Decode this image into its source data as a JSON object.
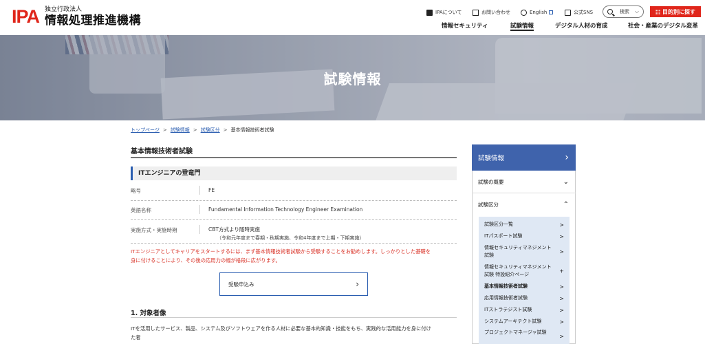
{
  "header": {
    "logo_mark": "IPA",
    "logo_sub": "独立行政法人",
    "logo_main": "情報処理推進機構",
    "util_links": [
      {
        "label": "IPAについて",
        "icon": "square-icon"
      },
      {
        "label": "お問い合わせ",
        "icon": "mail-icon"
      },
      {
        "label": "English",
        "icon": "globe-icon"
      },
      {
        "label": "公式SNS",
        "icon": "sns-icon"
      }
    ],
    "search_label": "検索",
    "purpose_button": "目的別に探す",
    "nav": [
      "情報セキュリティ",
      "試験情報",
      "デジタル人材の育成",
      "社会・産業のデジタル変革"
    ],
    "active_nav": "試験情報",
    "brand_color": "#e0261b"
  },
  "hero": {
    "title": "試験情報"
  },
  "breadcrumb": [
    {
      "label": "トップページ",
      "link": true
    },
    {
      "label": "試験情報",
      "link": true
    },
    {
      "label": "試験区分",
      "link": true
    },
    {
      "label": "基本情報技術者試験",
      "link": false
    }
  ],
  "main": {
    "page_title": "基本情報技術者試験",
    "section_heading": "ITエンジニアの登竜門",
    "info": [
      {
        "key": "略号",
        "value": "FE"
      },
      {
        "key": "英語名称",
        "value": "Fundamental Information Technology Engineer Examination"
      },
      {
        "key": "実施方式・実施時期",
        "value": "CBT方式より随時実施",
        "note": "（令和元年度まで春期・秋期実施、令和4年度まで上期・下期実施）"
      }
    ],
    "red_text_line1": "ITエンジニアとしてキャリアをスタートするには、まず基本情報技術者試験から受験することをお勧めします。しっかりとした基礎を",
    "red_text_line2": "身に付けることにより、その後の応用力の幅が格段に広がります。",
    "apply_button": "受験申込み",
    "h2": "1. 対象者像",
    "body_line1": "ITを活用したサービス、製品、システム及びソフトウェアを作る人材に必要な基本的知識・技能をもち、実践的な活用能力を身に付け",
    "body_line2": "た者",
    "accent_color": "#2a5db0",
    "alert_color": "#d93025"
  },
  "sidebar": {
    "head": "試験情報",
    "rows": [
      "試験の概要",
      "試験区分"
    ],
    "rows_state": [
      "collapsed",
      "expanded"
    ],
    "sub_items": [
      {
        "label": "試験区分一覧",
        "mark": ">"
      },
      {
        "label": "ITパスポート試験",
        "mark": ">"
      },
      {
        "label": "情報セキュリティマネジメント試験",
        "mark": ">"
      },
      {
        "label": "情報セキュリティマネジメント試験 特設紹介ページ",
        "mark": "+"
      },
      {
        "label": "基本情報技術者試験",
        "mark": ">",
        "current": true
      },
      {
        "label": "応用情報技術者試験",
        "mark": ">"
      },
      {
        "label": "ITストラテジスト試験",
        "mark": ">"
      },
      {
        "label": "システムアーキテクト試験",
        "mark": ">"
      },
      {
        "label": "プロジェクトマネージャ試験",
        "mark": ">"
      }
    ],
    "head_color": "#3f63ac",
    "panel_color": "#dfe8f4"
  }
}
